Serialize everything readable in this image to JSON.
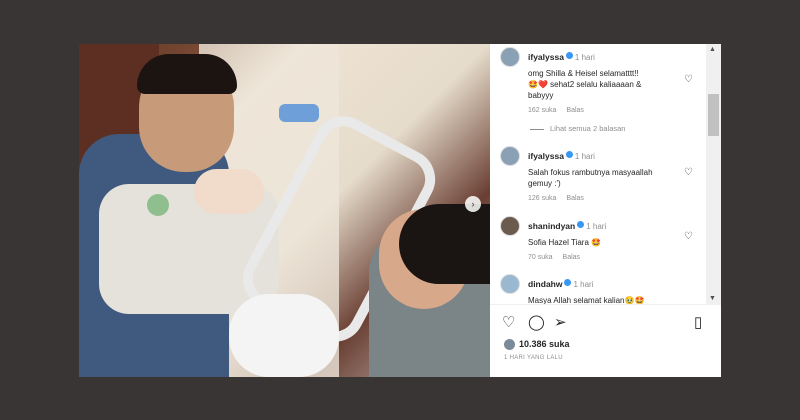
{
  "comments": [
    {
      "username": "ifyalyssa",
      "ago": "1 hari",
      "text_line1": "omg Shilla & Heisel selamatttt!!",
      "text_line2": "🤩❤️ sehat2 selalu kaliaaaan &",
      "text_line3": "babyyy",
      "likes": "162 suka",
      "reply": "Balas"
    },
    {
      "username": "ifyalyssa",
      "ago": "1 hari",
      "text_line1": "Salah fokus rambutnya masyaallah",
      "text_line2": "gemuy :')",
      "likes": "126 suka",
      "reply": "Balas"
    },
    {
      "username": "shanindyan",
      "ago": "1 hari",
      "text_line1": "Sofia Hazel Tiara 🤩",
      "likes": "70 suka",
      "reply": "Balas"
    },
    {
      "username": "dindahw",
      "ago": "1 hari",
      "text_line1": "Masya Allah selamat kalian🥹🤩"
    }
  ],
  "view_replies": "Lihat semua 2 balasan",
  "likes_total": "10.386 suka",
  "time_ago": "1 HARI YANG LALU",
  "icons": {
    "heart": "heart-icon",
    "comment": "comment-icon",
    "share": "share-icon",
    "save": "bookmark-icon",
    "next": "chevron-right-icon"
  }
}
